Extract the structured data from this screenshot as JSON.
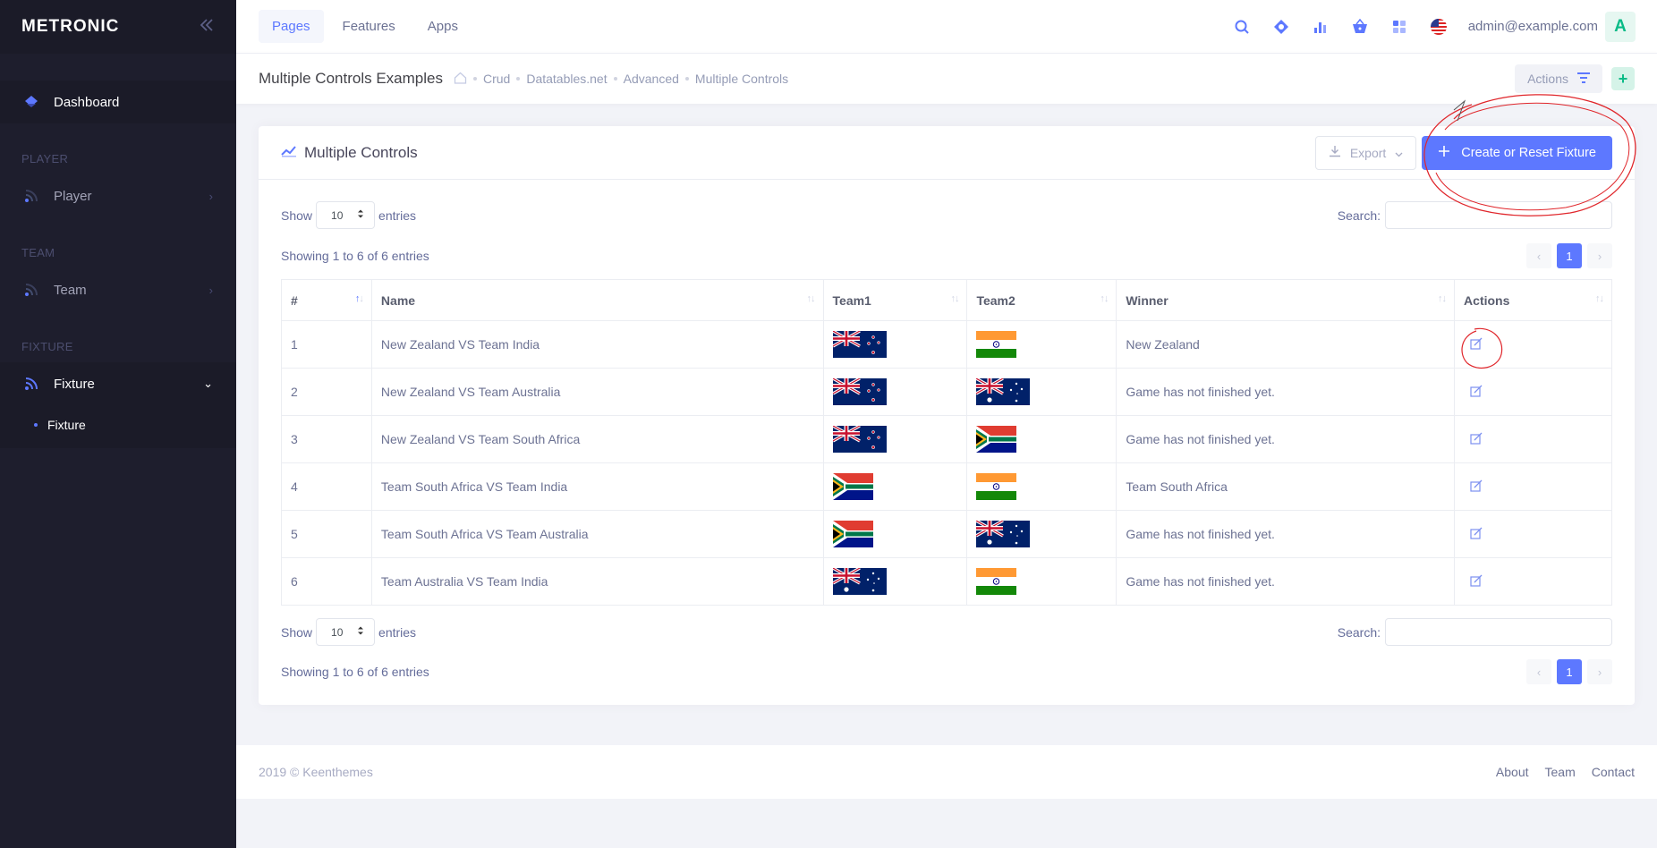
{
  "brand": {
    "logo": "METRONIC"
  },
  "sidebar": {
    "dashboard": "Dashboard",
    "sections": [
      {
        "title": "PLAYER",
        "item": "Player"
      },
      {
        "title": "TEAM",
        "item": "Team"
      },
      {
        "title": "FIXTURE",
        "item": "Fixture"
      }
    ],
    "submenu_item": "Fixture"
  },
  "header": {
    "nav": [
      "Pages",
      "Features",
      "Apps"
    ],
    "user_email": "admin@example.com",
    "avatar_letter": "A"
  },
  "subheader": {
    "title": "Multiple Controls Examples",
    "breadcrumbs": [
      "Crud",
      "Datatables.net",
      "Advanced",
      "Multiple Controls"
    ],
    "actions_label": "Actions",
    "add_label": "+"
  },
  "card": {
    "title": "Multiple Controls",
    "export_label": "Export",
    "create_label": "Create or Reset Fixture"
  },
  "table_controls": {
    "show_label": "Show",
    "entries_label": "entries",
    "length_value": "10",
    "search_label": "Search:",
    "info": "Showing 1 to 6 of 6 entries",
    "current_page": "1"
  },
  "table": {
    "columns": [
      "#",
      "Name",
      "Team1",
      "Team2",
      "Winner",
      "Actions"
    ],
    "rows": [
      {
        "id": "1",
        "name": "New Zealand VS Team India",
        "team1": "nz",
        "team2": "in",
        "winner": "New Zealand"
      },
      {
        "id": "2",
        "name": "New Zealand VS Team Australia",
        "team1": "nz",
        "team2": "au",
        "winner": "Game has not finished yet."
      },
      {
        "id": "3",
        "name": "New Zealand VS Team South Africa",
        "team1": "nz",
        "team2": "za",
        "winner": "Game has not finished yet."
      },
      {
        "id": "4",
        "name": "Team South Africa VS Team India",
        "team1": "za",
        "team2": "in",
        "winner": "Team South Africa"
      },
      {
        "id": "5",
        "name": "Team South Africa VS Team Australia",
        "team1": "za",
        "team2": "au",
        "winner": "Game has not finished yet."
      },
      {
        "id": "6",
        "name": "Team Australia VS Team India",
        "team1": "au",
        "team2": "in",
        "winner": "Game has not finished yet."
      }
    ]
  },
  "footer": {
    "copyright": "2019 © Keenthemes",
    "links": [
      "About",
      "Team",
      "Contact"
    ]
  },
  "colors": {
    "accent": "#5d78ff",
    "sidebar": "#1e1e2d",
    "success": "#0abb87",
    "annotation": "#e0262b"
  }
}
